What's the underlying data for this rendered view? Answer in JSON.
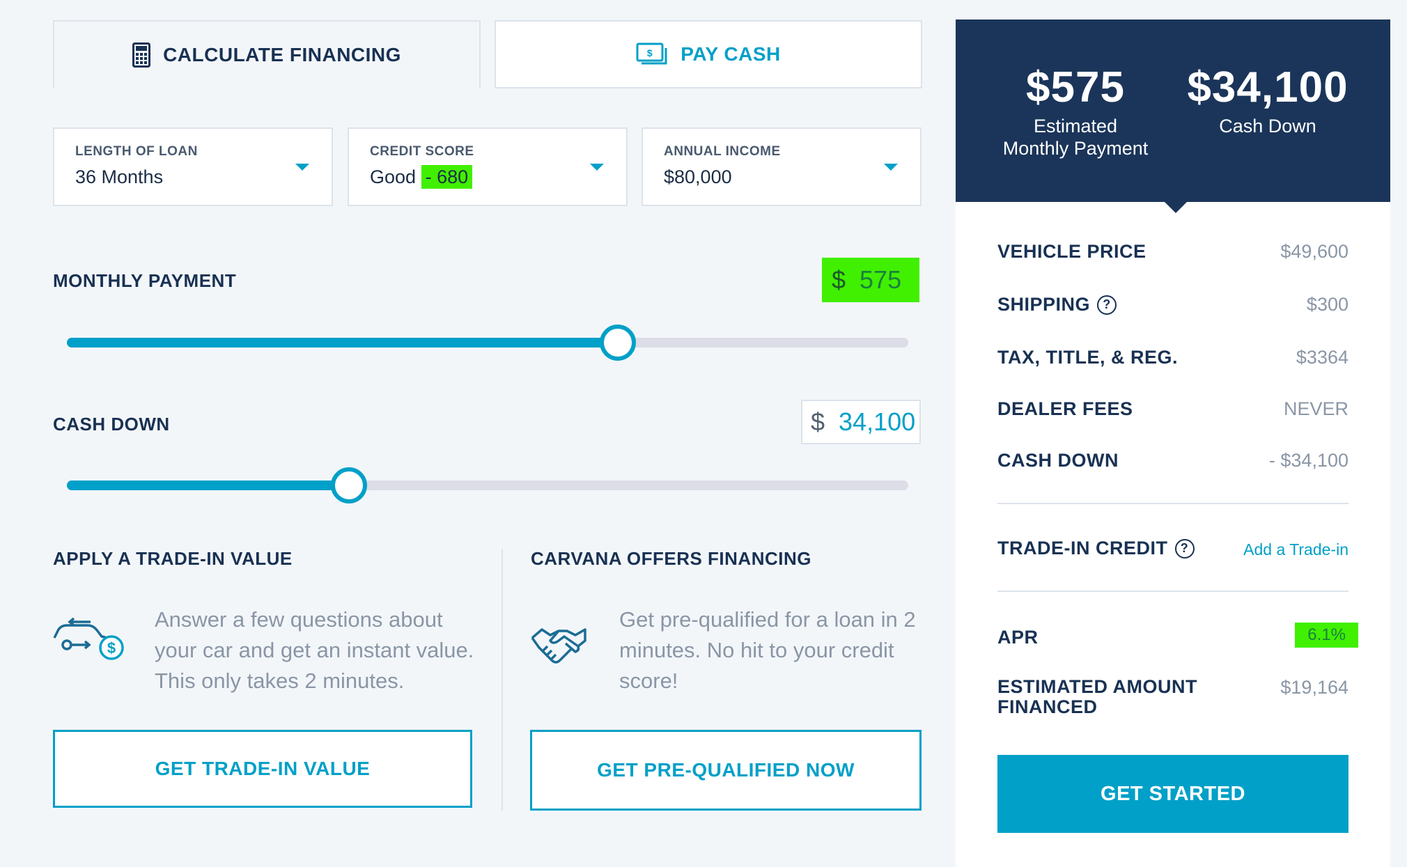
{
  "tabs": [
    {
      "label": "CALCULATE FINANCING",
      "icon": "calculator-icon"
    },
    {
      "label": "PAY CASH",
      "icon": "cash-icon"
    }
  ],
  "filters": {
    "loan": {
      "label": "LENGTH OF LOAN",
      "value": "36 Months"
    },
    "credit": {
      "label": "CREDIT SCORE",
      "value_prefix": "Good",
      "value_highlight": "- 680"
    },
    "income": {
      "label": "ANNUAL INCOME",
      "value": "$80,000"
    }
  },
  "monthly_payment": {
    "label": "MONTHLY PAYMENT",
    "currency": "$",
    "value": "575",
    "slider_fraction": 0.655
  },
  "cash_down": {
    "label": "CASH DOWN",
    "currency": "$",
    "value": "34,100",
    "slider_fraction": 0.335
  },
  "trade_in": {
    "title": "APPLY A TRADE-IN VALUE",
    "text": "Answer a few questions about your car and get an instant value. This only takes 2 minutes.",
    "button": "GET TRADE-IN VALUE"
  },
  "financing_offer": {
    "title": "CARVANA OFFERS FINANCING",
    "text": "Get pre-qualified for a loan in 2 minutes. No hit to your credit score!",
    "button": "GET PRE-QUALIFIED NOW"
  },
  "summary": {
    "payment_amount": "$575",
    "payment_label": "Estimated Monthly Payment",
    "cash_amount": "$34,100",
    "cash_label": "Cash Down",
    "vehicle_price": {
      "label": "VEHICLE PRICE",
      "value": "$49,600"
    },
    "shipping": {
      "label": "SHIPPING",
      "value": "$300"
    },
    "tax": {
      "label": "TAX, TITLE, & REG.",
      "value": "$3364"
    },
    "dealer_fees": {
      "label": "DEALER FEES",
      "value": "NEVER"
    },
    "cash_down": {
      "label": "CASH DOWN",
      "value": "- $34,100"
    },
    "trade_credit": {
      "label": "TRADE-IN CREDIT",
      "link": "Add a Trade-in"
    },
    "apr": {
      "label": "APR",
      "value": "6.1%"
    },
    "financed": {
      "label": "ESTIMATED AMOUNT FINANCED",
      "value": "$19,164"
    },
    "cta": "GET STARTED"
  },
  "colors": {
    "accent": "#00a0c8",
    "navy": "#1b355a",
    "highlight": "#40f000"
  }
}
